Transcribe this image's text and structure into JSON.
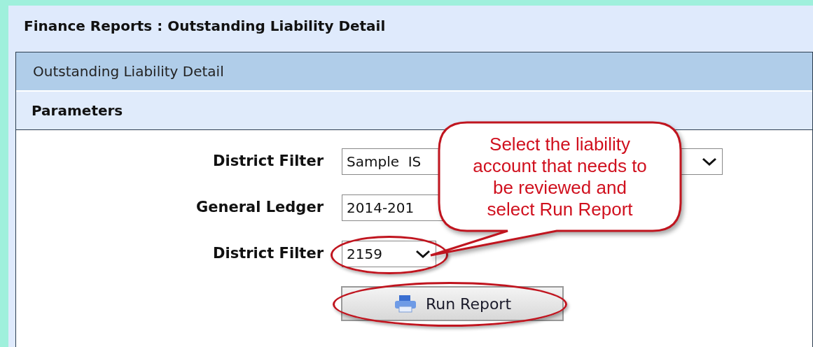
{
  "page_title": "Finance Reports : Outstanding Liability Detail",
  "panel_title": "Outstanding Liability Detail",
  "section_title": "Parameters",
  "fields": [
    {
      "label": "District Filter",
      "value": "Sample  IS",
      "kind": "wide",
      "highlighted": false
    },
    {
      "label": "General Ledger",
      "value": "2014-201",
      "kind": "medium",
      "highlighted": false
    },
    {
      "label": "District Filter",
      "value": "2159",
      "kind": "narrow",
      "highlighted": true
    }
  ],
  "run_button": {
    "label": "Run Report",
    "highlighted": true
  },
  "callout": {
    "text": "Select the liability account that needs to be reviewed and select Run Report"
  }
}
